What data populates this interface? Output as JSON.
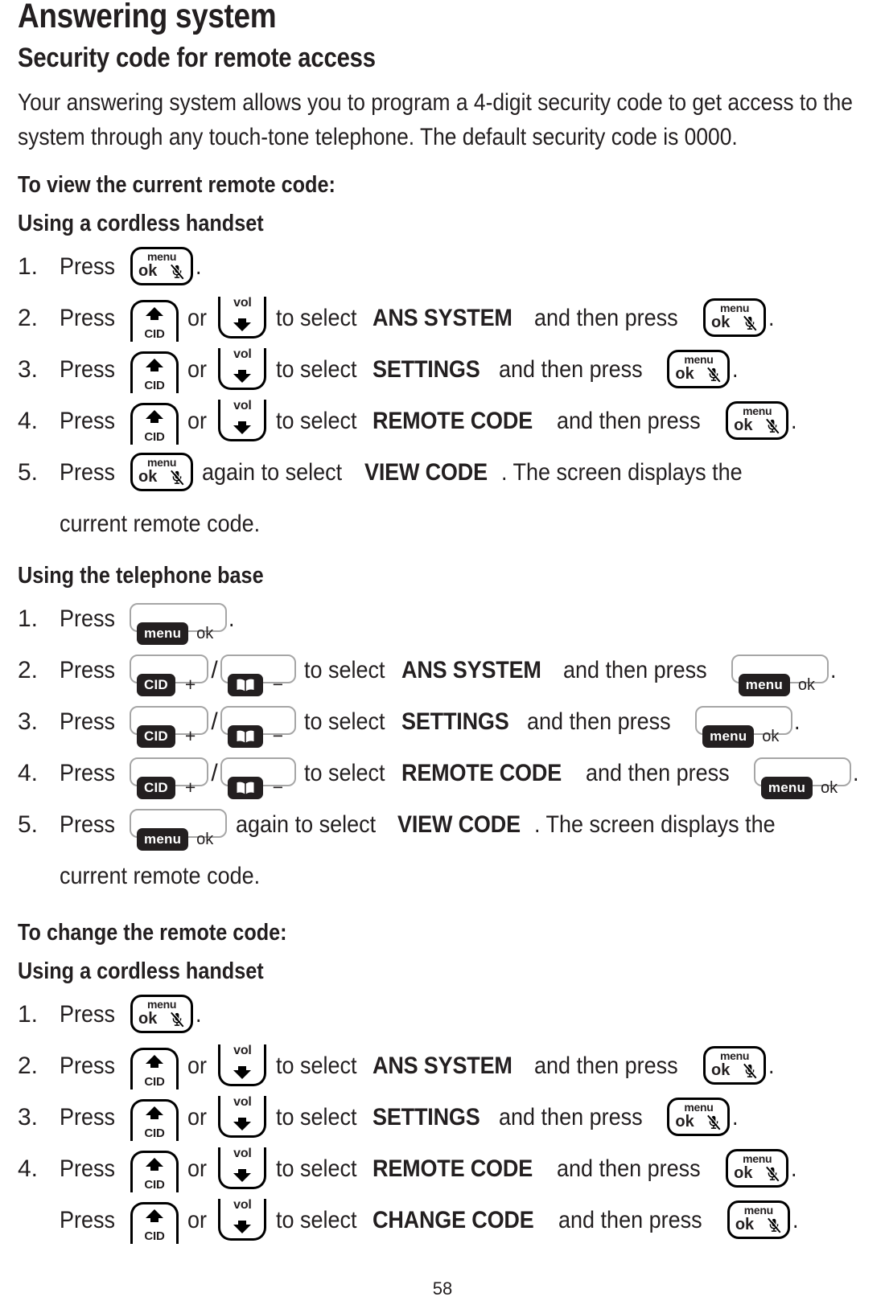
{
  "document": {
    "title": "Answering system",
    "section_title": "Security code for remote access",
    "intro_paragraph": "Your answering system allows you to program a 4-digit security code to get access to the system through any touch-tone telephone. The default security code is 0000.",
    "page_number": "58"
  },
  "keys": {
    "handset_menu_ok": {
      "menu": "menu",
      "ok": "ok",
      "icon": "mute-mic-icon"
    },
    "handset_cid_up": {
      "label": "CID",
      "icon": "triangle-up-icon"
    },
    "handset_vol_down": {
      "label": "vol",
      "icon": "triangle-down-icon"
    },
    "base_menu_ok": {
      "chip": "menu",
      "label": "ok"
    },
    "base_cid_plus": {
      "chip": "CID",
      "label": "+"
    },
    "base_book_minus": {
      "chip_icon": "open-book-icon",
      "label": "−"
    }
  },
  "sections": [
    {
      "heading": "To view the current remote code:",
      "groups": [
        {
          "subheading": "Using a cordless handset",
          "device": "handset",
          "steps": [
            {
              "num": "1.",
              "pre": "Press",
              "key1": "menuok",
              "post": "."
            },
            {
              "num": "2.",
              "pre": "Press",
              "key1": "cidup",
              "mid": "or",
              "key2": "voldn",
              "post_pre": "to select",
              "selection": "ANS SYSTEM",
              "post_mid": "and then press",
              "key3": "menuok",
              "post": "."
            },
            {
              "num": "3.",
              "pre": " Press",
              "key1": "cidup",
              "mid": "or",
              "key2": "voldn",
              "post_pre": "to select",
              "selection": "SETTINGS",
              "post_mid": "and then press",
              "key3": "menuok",
              "post": "."
            },
            {
              "num": "4.",
              "pre": "Press",
              "key1": "cidup",
              "mid": "or",
              "key2": "voldn",
              "post_pre": "to select",
              "selection": "REMOTE CODE",
              "post_mid": "and then press",
              "key3": "menuok",
              "post": "."
            },
            {
              "num": "5.",
              "pre": "Press",
              "key1": "menuok",
              "post_pre": "again to select",
              "selection": "VIEW CODE",
              "post": ". The screen displays the",
              "continuation": "current remote code."
            }
          ]
        },
        {
          "subheading": "Using the telephone base",
          "device": "base",
          "steps": [
            {
              "num": "1.",
              "pre": "Press",
              "key1": "basemenuok",
              "post": "."
            },
            {
              "num": "2.",
              "pre": "Press",
              "key1": "basecid",
              "sep": "/",
              "key2": "basebook",
              "post_pre": "to select",
              "selection": "ANS SYSTEM",
              "post_mid": "and then press",
              "key3": "basemenuok",
              "post": "."
            },
            {
              "num": "3.",
              "pre": "Press",
              "key1": "basecid",
              "sep": "/",
              "key2": "basebook",
              "post_pre": "to select",
              "selection": "SETTINGS",
              "post_mid": "and then press",
              "key3": "basemenuok",
              "post": "."
            },
            {
              "num": "4.",
              "pre": "Press",
              "key1": "basecid",
              "sep": "/",
              "key2": "basebook",
              "post_pre": "to select",
              "selection": "REMOTE CODE",
              "post_mid": "and then press",
              "key3": "basemenuok",
              "post": "."
            },
            {
              "num": "5.",
              "pre": "Press",
              "key1": "basemenuok",
              "post_pre": "again to select",
              "selection": "VIEW CODE",
              "post": ". The screen displays the",
              "continuation": "current remote code."
            }
          ]
        }
      ]
    },
    {
      "heading": "To change the remote code:",
      "groups": [
        {
          "subheading": "Using a cordless handset",
          "device": "handset",
          "steps": [
            {
              "num": "1.",
              "pre": "Press",
              "key1": "menuok",
              "post": "."
            },
            {
              "num": "2.",
              "pre": "Press",
              "key1": "cidup",
              "mid": "or",
              "key2": "voldn",
              "post_pre": "to select",
              "selection": "ANS SYSTEM",
              "post_mid": "and then press",
              "key3": "menuok",
              "post": "."
            },
            {
              "num": "3.",
              "pre": " Press",
              "key1": "cidup",
              "mid": "or",
              "key2": "voldn",
              "post_pre": "to select",
              "selection": "SETTINGS",
              "post_mid": "and then press",
              "key3": "menuok",
              "post": "."
            },
            {
              "num": "4.",
              "pre": "Press",
              "key1": "cidup",
              "mid": "or",
              "key2": "voldn",
              "post_pre": "to select",
              "selection": "REMOTE CODE",
              "post_mid": "and then press",
              "key3": "menuok",
              "post": "."
            },
            {
              "num": "",
              "pre": "Press",
              "key1": "cidup",
              "mid": "or",
              "key2": "voldn",
              "post_pre": "to select",
              "selection": "CHANGE CODE",
              "post_mid": "and then press",
              "key3": "menuok",
              "post": "."
            }
          ]
        }
      ]
    }
  ]
}
